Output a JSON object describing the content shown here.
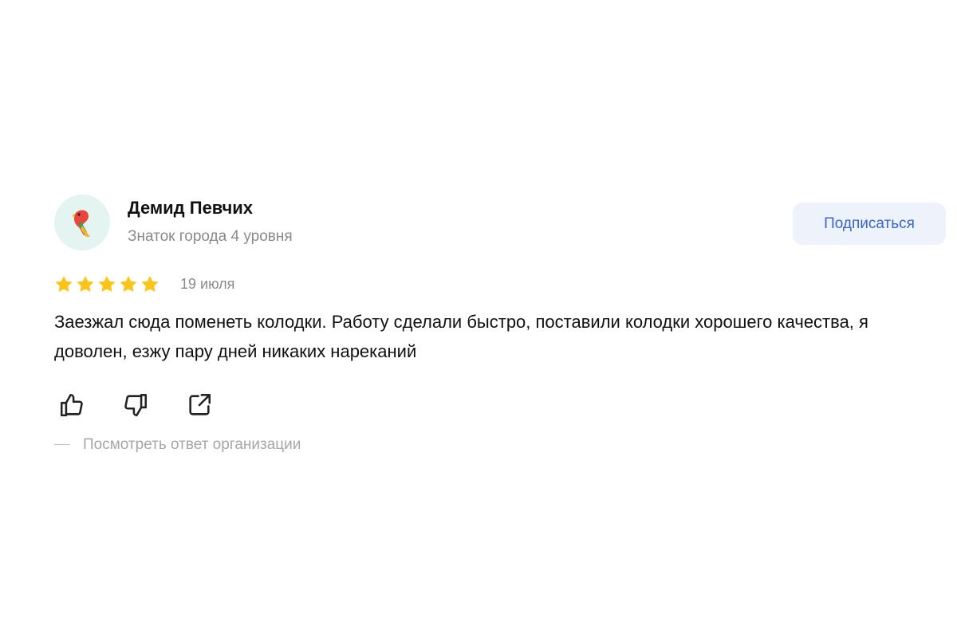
{
  "review": {
    "author": {
      "name": "Демид Певчих",
      "level": "Знаток города 4 уровня",
      "avatar_icon": "parrot-icon"
    },
    "subscribe_label": "Подписаться",
    "rating": 5,
    "rating_max": 5,
    "date": "19 июля",
    "text": "Заезжал сюда поменеть колодки. Работу сделали быстро, поставили колодки хорошего качества, я доволен, езжу пару дней никаких нареканий",
    "actions": [
      "thumbs-up-icon",
      "thumbs-down-icon",
      "share-icon"
    ],
    "response_link": "Посмотреть ответ организации"
  },
  "colors": {
    "accent": "#3a66c9",
    "star": "#fcc419",
    "secondary_text": "#8a8a8a",
    "button_bg": "#eef3fb"
  }
}
